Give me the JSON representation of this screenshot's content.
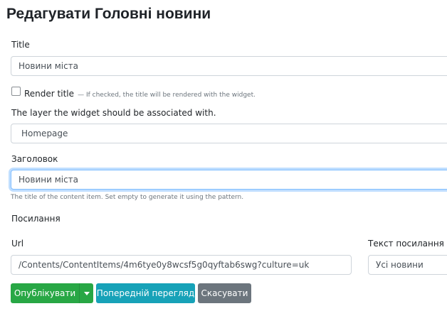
{
  "page": {
    "title": "Редагувати Головні новини"
  },
  "title_field": {
    "label": "Title",
    "value": "Новини міста"
  },
  "render_title": {
    "label": "Render title",
    "hint": "— If checked, the title will be rendered with the widget.",
    "checked": false
  },
  "layer": {
    "label": "The layer the widget should be associated with.",
    "value": "Homepage"
  },
  "heading_field": {
    "label": "Заголовок",
    "value": "Новини міста",
    "hint": "The title of the content item. Set empty to generate it using the pattern."
  },
  "link_section": {
    "label": "Посилання"
  },
  "url_field": {
    "label": "Url",
    "value": "/Contents/ContentItems/4m6tye0y8wcsf5g0qyftab6swg?culture=uk"
  },
  "link_text_field": {
    "label": "Текст посилання",
    "value": "Усі новини"
  },
  "actions": {
    "publish": "Опублікувати",
    "preview": "Попередній перегляд",
    "cancel": "Скасувати"
  },
  "colors": {
    "success": "#28a745",
    "info": "#17a2b8",
    "secondary": "#6c757d",
    "focus": "#80bdff"
  }
}
